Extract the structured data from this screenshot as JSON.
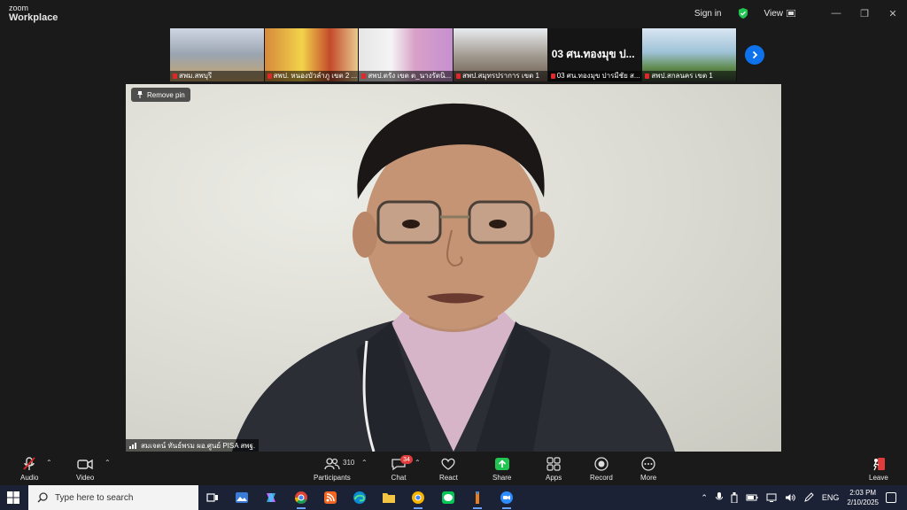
{
  "app": {
    "logo_line1": "zoom",
    "logo_line2": "Workplace",
    "sign_in": "Sign in",
    "view_label": "View"
  },
  "window_controls": {
    "minimize": "—",
    "restore": "❐",
    "close": "✕"
  },
  "thumbnails": [
    {
      "label": "สพม.สพบุรี",
      "bg": "#8a8f7a"
    },
    {
      "label": "สพป. หนองบัวลำภู เขต 2 ...",
      "bg": "#c97a3a"
    },
    {
      "label": "สพป.ตรัง เขต ต_นางรัตนิ...",
      "bg": "#b79ec9"
    },
    {
      "label": "สพป.สมุทรปราการ เขต 1",
      "bg": "#7c7a6e"
    },
    {
      "label": "03 ศน.ทองมุข  ปารมีชัย ส...",
      "bg": "#222222",
      "overlay_text": "03 ศน.ทองมุข  ป..."
    },
    {
      "label": "สพป.สกลนคร เขต 1",
      "bg": "#6e8fa8"
    }
  ],
  "main_video": {
    "remove_pin": "Remove pin",
    "speaker": "สมเจตน์ ทันธ์พรม ผอ.ศูนย์ PISA สพฐ."
  },
  "toolbar": {
    "audio": "Audio",
    "video": "Video",
    "participants": "Participants",
    "participants_count": "310",
    "chat": "Chat",
    "chat_badge": "34",
    "react": "React",
    "share": "Share",
    "apps": "Apps",
    "record": "Record",
    "more": "More",
    "leave": "Leave"
  },
  "taskbar": {
    "search_placeholder": "Type here to search",
    "lang": "ENG",
    "time": "2:03 PM",
    "date": "2/10/2025"
  },
  "colors": {
    "accent_blue": "#0e72ed",
    "share_green": "#23c552",
    "mute_red": "#e02828",
    "leave_red": "#e03c3c"
  }
}
